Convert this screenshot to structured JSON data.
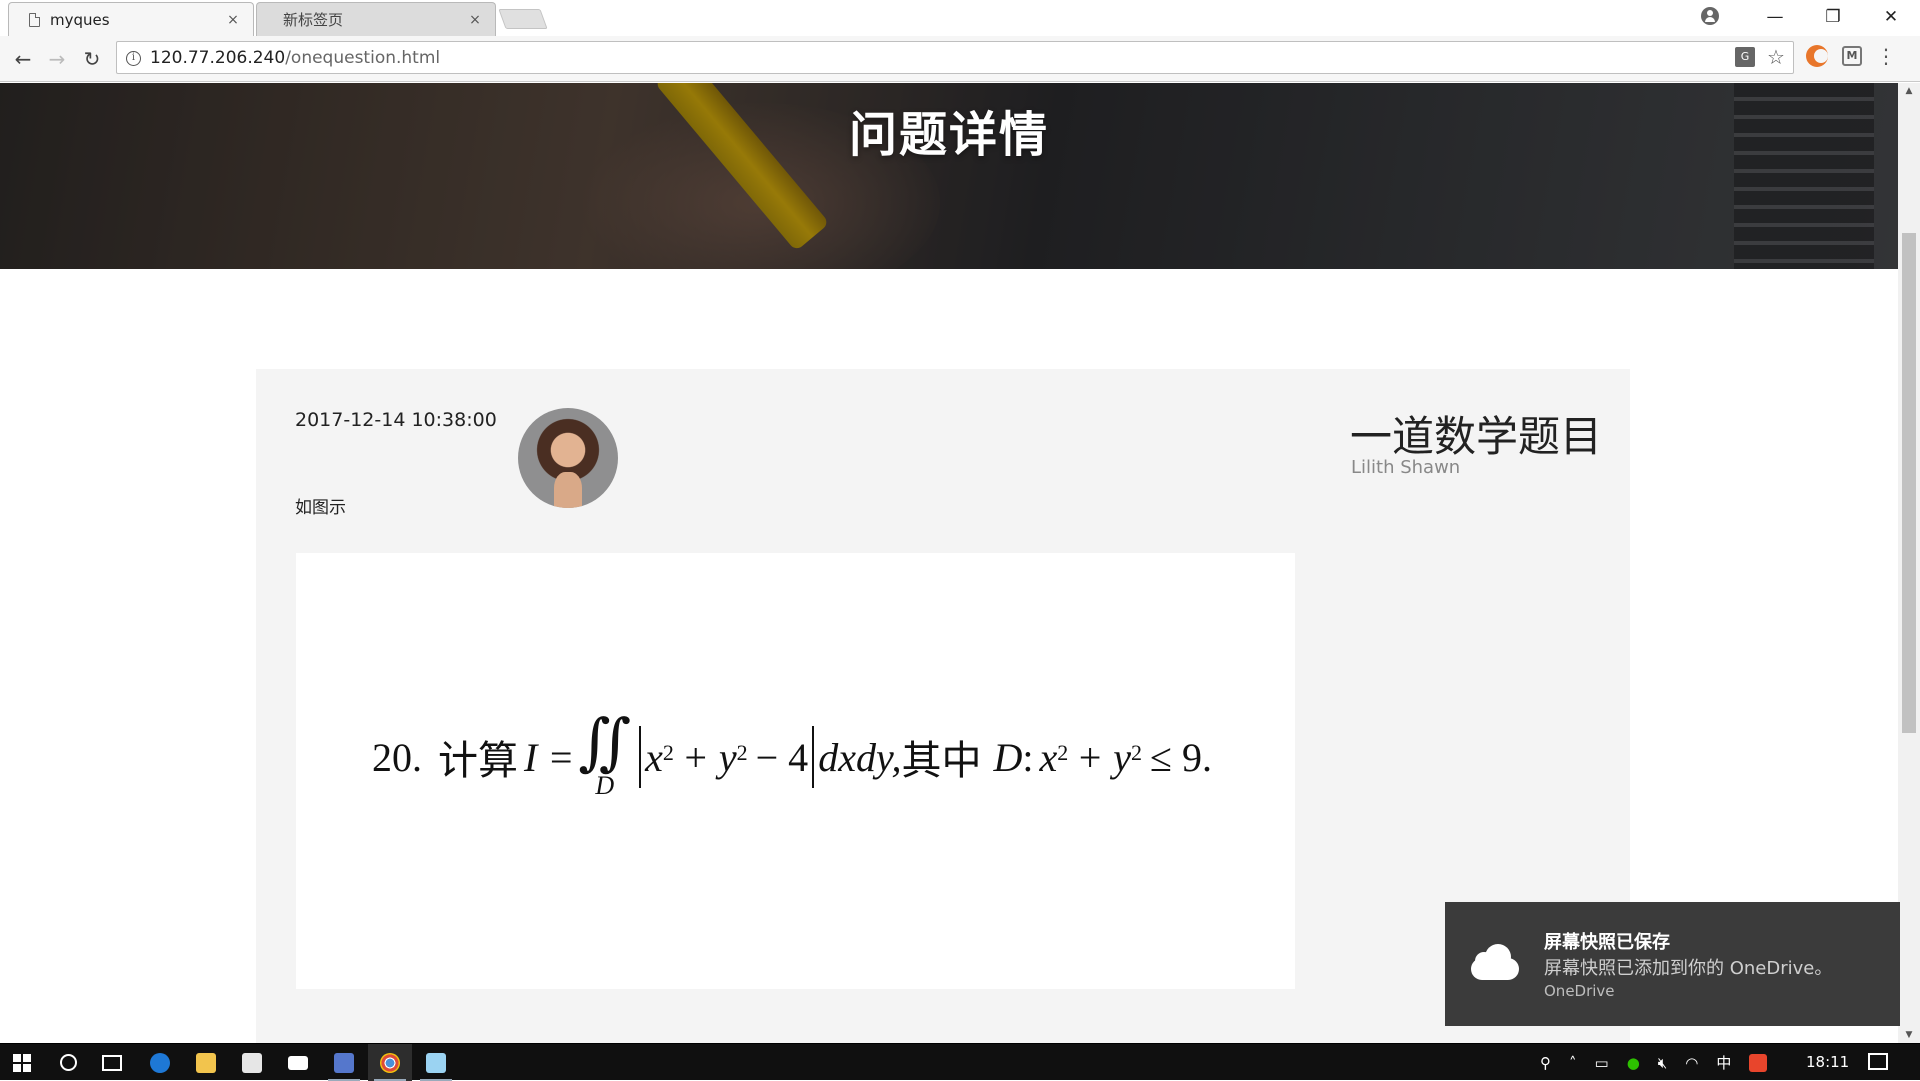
{
  "browser": {
    "tabs": [
      {
        "label": "myques",
        "close": "×"
      },
      {
        "label": "新标签页",
        "close": "×"
      }
    ],
    "url_host": "120.77.206.240",
    "url_path": "/onequestion.html",
    "window_controls": {
      "minimize": "—",
      "restore": "❐",
      "close": "✕"
    },
    "nav": {
      "back": "←",
      "forward": "→",
      "reload": "↻"
    }
  },
  "page": {
    "hero_title": "问题详情",
    "post": {
      "time": "2017-12-14 10:38:00",
      "body": "如图示",
      "title": "一道数学题目",
      "author": "Lilith Shawn"
    },
    "formula": {
      "number": "20.",
      "prefix": "计算",
      "lhs": "I =",
      "integral": "∬",
      "domain": "D",
      "integrand_a": "x",
      "integrand_b": "+ y",
      "integrand_c": "− 4",
      "diff": "dxdy,",
      "mid": "其中",
      "d_var": "D",
      "colon": ":",
      "cond_x": "x",
      "cond_y": "+ y",
      "cond_tail": "≤ 9.",
      "exp": "2"
    }
  },
  "notification": {
    "title": "屏幕快照已保存",
    "message": "屏幕快照已添加到你的 OneDrive。",
    "source": "OneDrive"
  },
  "taskbar": {
    "clock": "18:11",
    "ime": "中",
    "colors": {
      "background": "#101010",
      "accent": "#4a90d9"
    }
  }
}
